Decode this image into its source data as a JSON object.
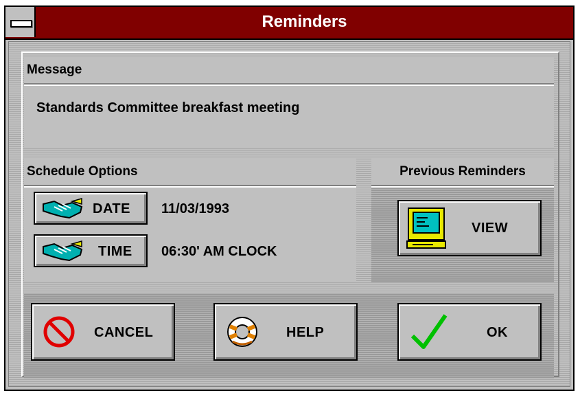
{
  "window": {
    "title": "Reminders"
  },
  "message": {
    "heading": "Message",
    "text": "Standards Committee breakfast meeting"
  },
  "schedule": {
    "heading": "Schedule Options",
    "date_label": "DATE",
    "date_value": "11/03/1993",
    "time_label": "TIME",
    "time_value": "06:30' AM CLOCK"
  },
  "previous": {
    "heading": "Previous Reminders",
    "view_label": "VIEW"
  },
  "buttons": {
    "cancel": "CANCEL",
    "help": "HELP",
    "ok": "OK"
  },
  "icons": {
    "date": "handshake-icon",
    "time": "handshake-icon",
    "view": "computer-icon",
    "cancel": "no-sign-icon",
    "help": "lifebuoy-icon",
    "ok": "checkmark-icon"
  },
  "colors": {
    "titlebar": "#800000",
    "face": "#c0c0c0",
    "cancel_red": "#e00000",
    "ok_green": "#00c000",
    "computer_screen": "#00c0c0"
  }
}
